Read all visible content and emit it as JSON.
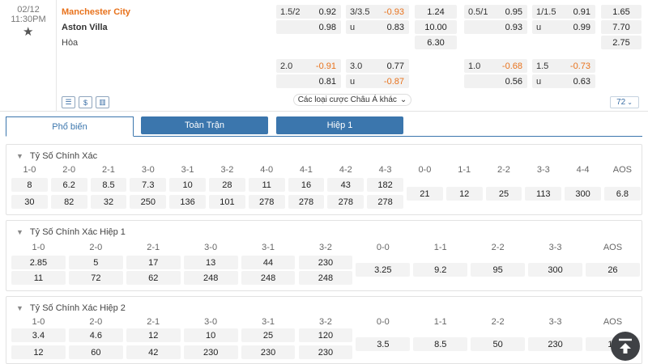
{
  "match": {
    "date": "02/12",
    "time": "11:30PM",
    "home": "Manchester City",
    "away": "Aston Villa",
    "draw": "Hòa",
    "main_rows": [
      {
        "ah_line": "1.5/2",
        "ah_home": "0.92",
        "ou_line": "3/3.5",
        "ou_over": "-0.93",
        "x12": "1.24",
        "h1_ah_line": "0.5/1",
        "h1_ah_home": "0.95",
        "h1_ou_line": "1/1.5",
        "h1_ou_over": "0.91",
        "h1_x12": "1.65"
      },
      {
        "ah_away": "0.98",
        "ou_under_label": "u",
        "ou_under": "0.83",
        "x12": "10.00",
        "h1_ah_away": "0.93",
        "h1_ou_under_label": "u",
        "h1_ou_under": "0.99",
        "h1_x12": "7.70"
      },
      {
        "x12": "6.30",
        "h1_x12": "2.75"
      }
    ],
    "alt_rows": [
      {
        "ah_line": "2.0",
        "ah_home": "-0.91",
        "ou_line": "3.0",
        "ou_over": "0.77",
        "h1_ah_line": "1.0",
        "h1_ah_home": "-0.68",
        "h1_ou_line": "1.5",
        "h1_ou_over": "-0.73"
      },
      {
        "ah_away": "0.81",
        "ou_under_label": "u",
        "ou_under": "-0.87",
        "h1_ah_away": "0.56",
        "h1_ou_under_label": "u",
        "h1_ou_under": "0.63"
      }
    ],
    "more_bets_label": "Các loại cược Châu Á khác",
    "more_count": "72"
  },
  "tabs": [
    "Phổ biến",
    "Toàn Trận",
    "Hiệp 1"
  ],
  "panels": [
    {
      "title": "Tỷ Số Chính Xác",
      "headers": [
        "1-0",
        "2-0",
        "2-1",
        "3-0",
        "3-1",
        "3-2",
        "4-0",
        "4-1",
        "4-2",
        "4-3",
        "0-0",
        "1-1",
        "2-2",
        "3-3",
        "4-4",
        "AOS"
      ],
      "home_row": [
        "8",
        "6.2",
        "8.5",
        "7.3",
        "10",
        "28",
        "11",
        "16",
        "43",
        "182"
      ],
      "away_row": [
        "30",
        "82",
        "32",
        "250",
        "136",
        "101",
        "278",
        "278",
        "278",
        "278"
      ],
      "draw_row": [
        "21",
        "12",
        "25",
        "113",
        "300",
        "6.8"
      ]
    },
    {
      "title": "Tỷ Số Chính Xác Hiệp 1",
      "headers": [
        "1-0",
        "2-0",
        "2-1",
        "3-0",
        "3-1",
        "3-2",
        "0-0",
        "1-1",
        "2-2",
        "3-3",
        "AOS"
      ],
      "home_row": [
        "2.85",
        "5",
        "17",
        "13",
        "44",
        "230"
      ],
      "away_row": [
        "11",
        "72",
        "62",
        "248",
        "248",
        "248"
      ],
      "draw_row": [
        "3.25",
        "9.2",
        "95",
        "300",
        "26"
      ]
    },
    {
      "title": "Tỷ Số Chính Xác Hiệp 2",
      "headers": [
        "1-0",
        "2-0",
        "2-1",
        "3-0",
        "3-1",
        "3-2",
        "0-0",
        "1-1",
        "2-2",
        "3-3",
        "AOS"
      ],
      "home_row": [
        "3.4",
        "4.6",
        "12",
        "10",
        "25",
        "120"
      ],
      "away_row": [
        "12",
        "60",
        "42",
        "230",
        "230",
        "230"
      ],
      "draw_row": [
        "3.5",
        "8.5",
        "50",
        "230",
        "13"
      ]
    }
  ],
  "colors": {
    "accent": "#3b76ad",
    "highlight": "#e8721c"
  }
}
